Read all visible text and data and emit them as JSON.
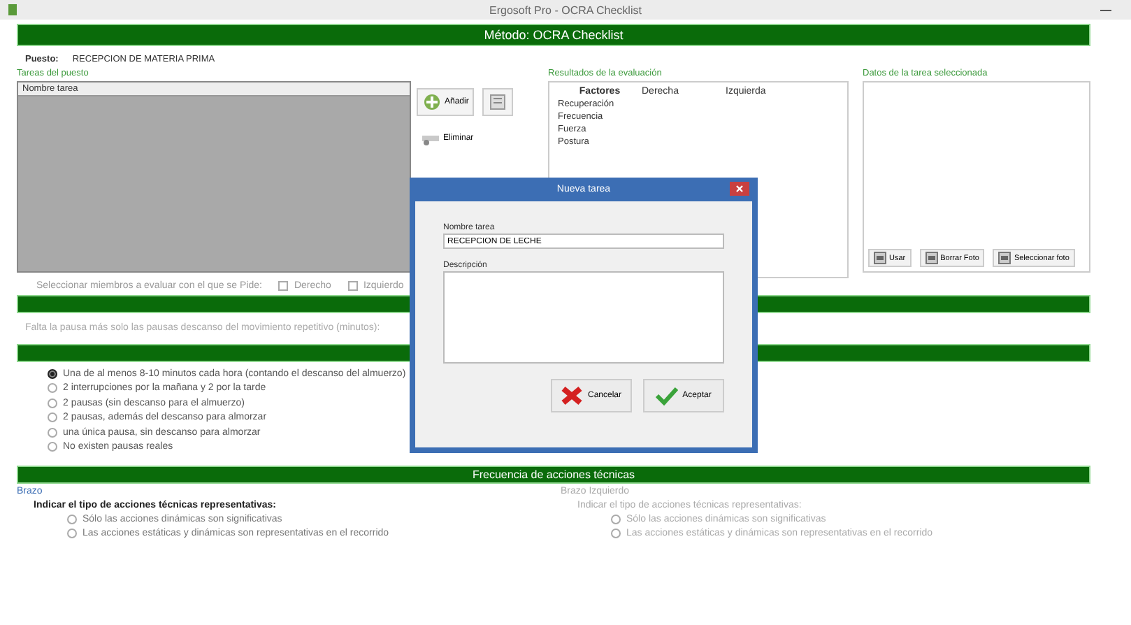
{
  "window": {
    "title": "Ergosoft Pro - OCRA Checklist"
  },
  "header": "Método: OCRA Checklist",
  "puesto": {
    "label": "Puesto:",
    "value": "RECEPCION DE MATERIA PRIMA"
  },
  "tasks": {
    "title": "Tareas del puesto",
    "column": "Nombre tarea",
    "buttons": [
      {
        "label": "Añadir",
        "kind": "add"
      },
      {
        "kind": "edit"
      },
      {
        "label": "Eliminar",
        "kind": "remove"
      }
    ]
  },
  "results": {
    "title": "Resultados de la evaluación",
    "columns": [
      "Factores",
      "Derecha",
      "Izquierda"
    ],
    "rows": [
      "Recuperación",
      "Frecuencia",
      "Fuerza",
      "Postura"
    ]
  },
  "photo": {
    "title": "Datos de la tarea seleccionada",
    "buttons": [
      "Usar",
      "Borrar Foto",
      "Seleccionar foto"
    ]
  },
  "limbs": {
    "label": "Seleccionar miembros a evaluar con el que se Pide:",
    "options": [
      {
        "label": "Derecho",
        "checked": false
      },
      {
        "label": "Izquierdo",
        "checked": false
      }
    ]
  },
  "section_note": "Falta la pausa más solo las pausas descanso del movimiento repetitivo (minutos):",
  "recovery": [
    {
      "label": "Una de al menos 8-10 minutos cada hora (contando el descanso del almuerzo)",
      "selected": true
    },
    {
      "label": "2 interrupciones por la mañana y 2 por la tarde",
      "selected": false
    },
    {
      "label": "2 pausas (sin descanso para el almuerzo)",
      "selected": false
    },
    {
      "label": "2 pausas, además del descanso para almorzar",
      "selected": false
    },
    {
      "label": "una única pausa, sin descanso para almorzar",
      "selected": false
    },
    {
      "label": "No existen pausas reales",
      "selected": false
    }
  ],
  "frequency": {
    "title": "Frecuencia de acciones técnicas",
    "columns": [
      {
        "title": "Brazo",
        "prompt": "Indicar el tipo de acciones técnicas representativas:",
        "enabled": true,
        "options": [
          {
            "label": "Sólo las acciones dinámicas son significativas",
            "selected": false
          },
          {
            "label": "Las acciones estáticas y dinámicas son representativas en el recorrido",
            "selected": false
          }
        ]
      },
      {
        "title": "Brazo Izquierdo",
        "prompt": "Indicar el tipo de acciones técnicas representativas:",
        "enabled": false,
        "options": [
          {
            "label": "Sólo las acciones dinámicas son significativas",
            "selected": false
          },
          {
            "label": "Las acciones estáticas y dinámicas son representativas en el recorrido",
            "selected": false
          }
        ]
      }
    ]
  },
  "dialog": {
    "title": "Nueva tarea",
    "name_label": "Nombre tarea",
    "name_value": "RECEPCION DE LECHE",
    "description_label": "Descripción",
    "buttons": [
      {
        "label": "Cancelar",
        "kind": "cancel"
      },
      {
        "label": "Aceptar",
        "kind": "ok"
      }
    ]
  }
}
